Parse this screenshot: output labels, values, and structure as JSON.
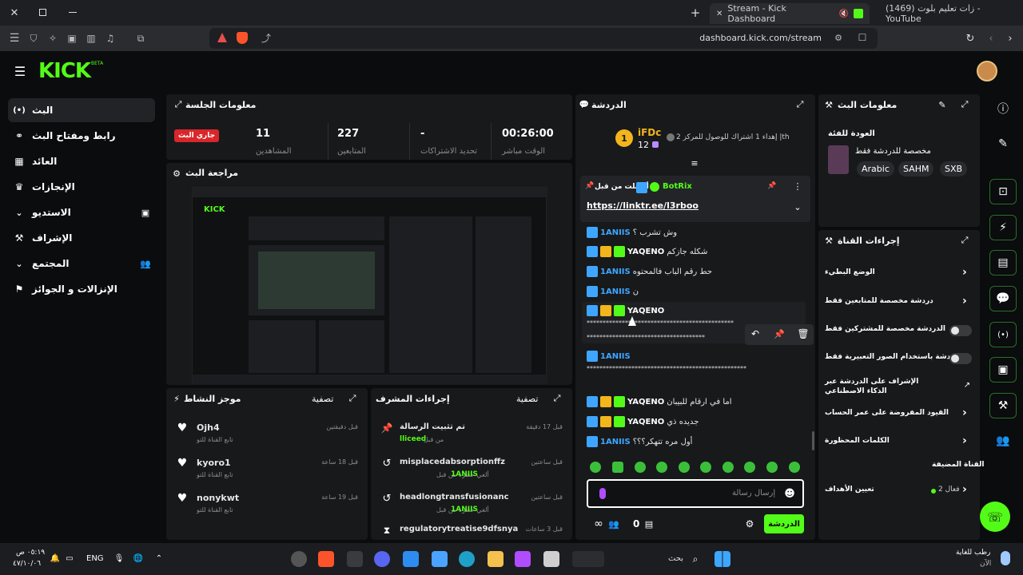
{
  "browser": {
    "tabs": [
      {
        "title": "Stream - Kick Dashboard",
        "active": true
      },
      {
        "title": "(1469) زات تعليم بلوت - YouTube",
        "active": false
      }
    ],
    "url": "dashboard.kick.com/stream"
  },
  "sidebar": {
    "items": [
      {
        "label": "البث",
        "icon": "broadcast-icon",
        "active": true
      },
      {
        "label": "رابط ومفتاح البث",
        "icon": "link-icon"
      },
      {
        "label": "العائد",
        "icon": "revenue-icon"
      },
      {
        "label": "الإنجازات",
        "icon": "trophy-icon"
      },
      {
        "label": "الاستديو",
        "icon": "chevron-down-icon"
      },
      {
        "label": "الإشراف",
        "icon": "hammer-icon"
      },
      {
        "label": "المجتمع",
        "icon": "chevron-down-icon"
      },
      {
        "label": "الإنزالات و الجوائز",
        "icon": "gift-icon"
      }
    ]
  },
  "session": {
    "title": "معلومات الجلسة",
    "live_badge": "جاري البث",
    "stats": [
      {
        "value": "11",
        "label": "المشاهدين"
      },
      {
        "value": "227",
        "label": "المتابعين"
      },
      {
        "value": "-",
        "label": "تحديد الاشتراكات"
      },
      {
        "value": "00:26:00",
        "label": "الوقت مباشر"
      }
    ]
  },
  "preview": {
    "title": "مراجعة البث"
  },
  "activity": {
    "title": "موجز النشاط",
    "filter": "تصفية",
    "items": [
      {
        "user": "Ojh4",
        "sub": "تابع القناة للتو",
        "time": "قبل دقيقتين"
      },
      {
        "user": "kyoro1",
        "sub": "تابع القناة للتو",
        "time": "قبل 18 ساعة"
      },
      {
        "user": "nonykwt",
        "sub": "تابع القناة للتو",
        "time": "قبل 19 ساعة"
      }
    ]
  },
  "modactions": {
    "title": "إجراءات المشرف",
    "filter": "تصفية",
    "items": [
      {
        "title": "تم تثبيت الرسالة",
        "by_prefix": "من قبل",
        "by": "lliceed",
        "time": "قبل 17 دقيقة"
      },
      {
        "title": "misplacedabsorptionffz",
        "by_prefix": "ألغي حظره من قبل",
        "by": "1ANIIS",
        "time": "قبل ساعتين"
      },
      {
        "title": "headlongtransfusionanc",
        "by_prefix": "ألغي حظره من قبل",
        "by": "1ANIIS",
        "time": "قبل ساعتين"
      },
      {
        "title": "regulatorytreatise9dfsnya",
        "by_prefix": "",
        "by": "",
        "time": "قبل 3 ساعات"
      }
    ]
  },
  "chat": {
    "title": "الدردشة",
    "top_gifter": {
      "name": "iFDc",
      "rank": "1",
      "count": "12",
      "goal": "إهداء 1 اشتراك للوصول للمركز 2 |th"
    },
    "pinned": {
      "prefix": "أرسلت من قبل",
      "user": "BotRix",
      "link": "https://linktr.ee/l3rboo"
    },
    "messages": [
      {
        "user": "1ANIIS",
        "text": "وش تشرب ؟",
        "color": "#3ea6ff"
      },
      {
        "user": "YAQENO",
        "text": "شكله جازكم",
        "color": "#ffffff"
      },
      {
        "user": "1ANIIS",
        "text": "حط رقم الباب فالمحتوه",
        "color": "#3ea6ff"
      },
      {
        "user": "1ANIIS",
        "text": "ن",
        "color": "#3ea6ff"
      },
      {
        "user": "YAQENO",
        "text": "",
        "color": "#ffffff"
      },
      {
        "user": "1ANIIS",
        "text": "",
        "color": "#3ea6ff"
      },
      {
        "user": "YAQENO",
        "text": "اما في ارقام للبيبان",
        "color": "#ffffff"
      },
      {
        "user": "YAQENO",
        "text": "جديده ذي",
        "color": "#ffffff"
      },
      {
        "user": "1ANIIS",
        "text": "أول مره تتهكر؟؟؟",
        "color": "#3ea6ff"
      }
    ],
    "stars_line_1": "**********************************************",
    "stars_line_2": "*************************************",
    "stars_line_3": "**************************************************",
    "input_placeholder": "إرسال رسالة",
    "send_label": "الدردشة",
    "count": "0"
  },
  "stream_info": {
    "title": "معلومات البث",
    "category": "العودة للفئة",
    "subtitle": "مخصصة للدردشة فقط",
    "tags": [
      "Arabic",
      "SAHM",
      "SXB"
    ]
  },
  "channel_actions": {
    "title": "إجراءات القناة",
    "rows": [
      {
        "label": "الوضع البطيء",
        "control": "chevron"
      },
      {
        "label": "دردشة مخصصة للمتابعين فقط",
        "control": "chevron"
      },
      {
        "label": "الدردشة مخصصة للمشتركين فقط",
        "control": "toggle"
      },
      {
        "label": "الدردشة باستخدام الصور التعبيرية فقط",
        "control": "toggle"
      },
      {
        "label": "الإشراف على الدردشة عبر الذكاء الاصطناعي",
        "control": "external"
      },
      {
        "label": "القيود المفروضة على عمر الحساب",
        "control": "chevron"
      },
      {
        "label": "الكلمات المحظورة",
        "control": "chevron"
      }
    ],
    "featured_title": "القناة المضيفة",
    "goals_label": "تعيين الأهداف",
    "goals_value": "فعال 2"
  },
  "taskbar": {
    "time": "٠٥:١٩ ص",
    "date": "٤٧/١٠/٠٦",
    "lang": "ENG",
    "search": "بحث",
    "weather": "رطب للغاية",
    "weather_sub": "الآن"
  },
  "colors": {
    "accent": "#53fc18",
    "bg": "#0b0c0d",
    "panel": "#18191b"
  }
}
